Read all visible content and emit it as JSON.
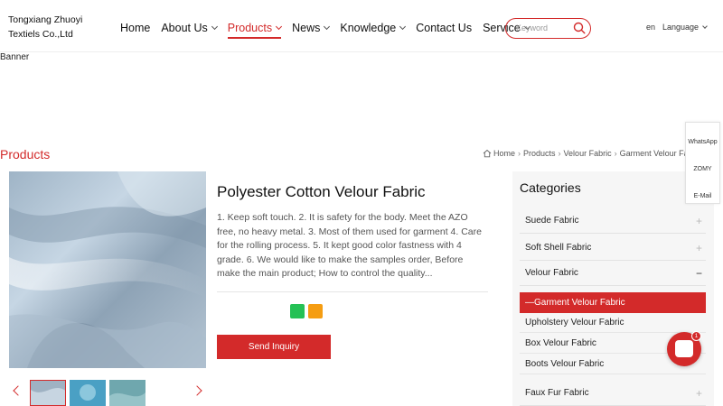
{
  "header": {
    "company_name": "Tongxiang Zhuoyi Textiels Co.,Ltd",
    "nav": [
      {
        "label": "Home"
      },
      {
        "label": "About Us"
      },
      {
        "label": "Products"
      },
      {
        "label": "News"
      },
      {
        "label": "Knowledge"
      },
      {
        "label": "Contact Us"
      },
      {
        "label": "Service"
      }
    ],
    "active_nav": "Products",
    "search_placeholder": "Keyword",
    "lang_code": "en",
    "language_label": "Language"
  },
  "banner_alt": "Banner",
  "section_title": "Products",
  "breadcrumb": [
    "Home",
    "Products",
    "Velour Fabric",
    "Garment Velour Fabric"
  ],
  "product": {
    "title": "Polyester Cotton Velour Fabric",
    "description": "1. Keep soft touch. 2. It is safety for the body. Meet the AZO free, no heavy metal. 3. Most of them used for garment 4. Care for the rolling process. 5. It kept good color fastness with 4 grade. 6. We would like to make the samples order, Before make the main product; How to control the quality...",
    "inquiry_label": "Send Inquiry"
  },
  "categories": {
    "title": "Categories",
    "items": [
      {
        "label": "Suede Fabric",
        "toggle": "+"
      },
      {
        "label": "Soft Shell Fabric",
        "toggle": "+"
      },
      {
        "label": "Velour Fabric",
        "toggle": "−"
      }
    ],
    "sub_items": [
      {
        "label": "—Garment Velour Fabric"
      },
      {
        "label": "Upholstery Velour Fabric"
      },
      {
        "label": "Box Velour Fabric"
      },
      {
        "label": "Boots Velour Fabric"
      }
    ],
    "after_items": [
      {
        "label": "Faux Fur Fabric",
        "toggle": "+"
      }
    ]
  },
  "float_bar": {
    "whatsapp": "WhatsApp",
    "zomy": "ZOMY",
    "email": "E-Mail"
  },
  "chat": {
    "badge": "1"
  },
  "colors": {
    "accent": "#d32a2a",
    "whatsapp": "#25c155",
    "share_orange": "#f59d12",
    "panel_bg": "#f6f6f6"
  }
}
